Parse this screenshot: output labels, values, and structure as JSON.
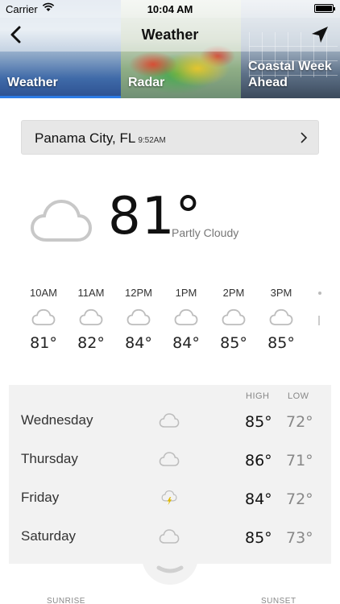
{
  "status_bar": {
    "carrier": "Carrier",
    "time": "10:04 AM"
  },
  "nav": {
    "title": "Weather",
    "back_icon": "chevron-left-icon",
    "locate_icon": "location-arrow-icon"
  },
  "tiles": [
    {
      "label": "Weather",
      "active": true
    },
    {
      "label": "Radar",
      "active": false
    },
    {
      "label": "Ahead",
      "label_top": "Coastal Week",
      "active": false
    }
  ],
  "accent_color": "#2c7be5",
  "location": {
    "city": "Panama City, FL",
    "time": "9:52AM"
  },
  "current": {
    "temp": "81°",
    "condition": "Partly Cloudy",
    "icon": "cloud-icon"
  },
  "hourly": [
    {
      "time": "10AM",
      "temp": "81°",
      "icon": "cloud-icon"
    },
    {
      "time": "11AM",
      "temp": "82°",
      "icon": "cloud-icon"
    },
    {
      "time": "12PM",
      "temp": "84°",
      "icon": "cloud-icon"
    },
    {
      "time": "1PM",
      "temp": "84°",
      "icon": "cloud-icon"
    },
    {
      "time": "2PM",
      "temp": "85°",
      "icon": "cloud-icon"
    },
    {
      "time": "3PM",
      "temp": "85°",
      "icon": "cloud-icon"
    }
  ],
  "daily": {
    "high_label": "HIGH",
    "low_label": "LOW",
    "days": [
      {
        "name": "Wednesday",
        "high": "85°",
        "low": "72°",
        "icon": "cloud-icon"
      },
      {
        "name": "Thursday",
        "high": "86°",
        "low": "71°",
        "icon": "cloud-icon"
      },
      {
        "name": "Friday",
        "high": "84°",
        "low": "72°",
        "icon": "thunderstorm-icon"
      },
      {
        "name": "Saturday",
        "high": "85°",
        "low": "73°",
        "icon": "cloud-icon"
      }
    ]
  },
  "sun": {
    "sunrise_label": "SUNRISE",
    "sunset_label": "SUNSET"
  }
}
